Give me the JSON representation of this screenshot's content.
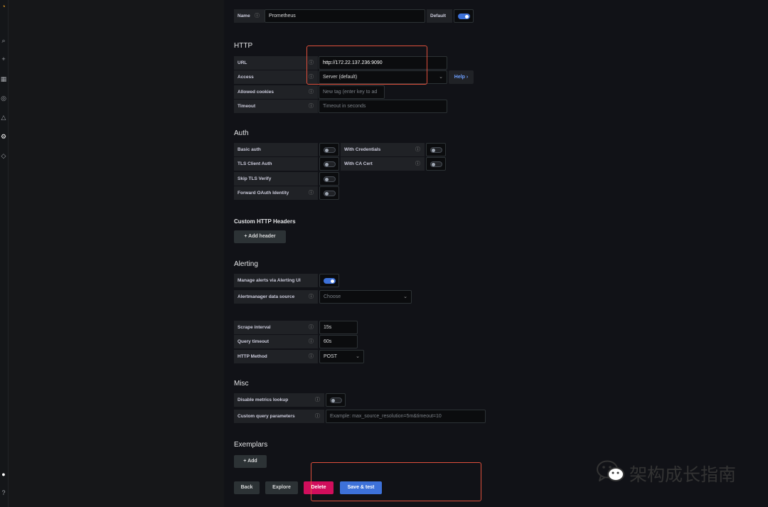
{
  "sidebar": {
    "icons": [
      "grafana-logo-icon",
      "search-icon",
      "plus-icon",
      "dashboards-icon",
      "explore-icon",
      "alerting-icon",
      "configuration-icon",
      "shield-icon",
      "user-avatar-icon",
      "help-icon"
    ]
  },
  "name_row": {
    "label": "Name",
    "value": "Prometheus",
    "default_label": "Default",
    "default_on": true
  },
  "http": {
    "title": "HTTP",
    "url_label": "URL",
    "url_value": "http://172.22.137.236:9090",
    "access_label": "Access",
    "access_value": "Server (default)",
    "help_label": "Help",
    "cookies_label": "Allowed cookies",
    "cookies_placeholder": "New tag (enter key to ad",
    "timeout_label": "Timeout",
    "timeout_placeholder": "Timeout in seconds"
  },
  "auth": {
    "title": "Auth",
    "basic_auth": "Basic auth",
    "with_credentials": "With Credentials",
    "tls_client_auth": "TLS Client Auth",
    "with_ca_cert": "With CA Cert",
    "skip_tls": "Skip TLS Verify",
    "forward_oauth": "Forward OAuth Identity"
  },
  "headers": {
    "title": "Custom HTTP Headers",
    "add_label": "+ Add header"
  },
  "alerting": {
    "title": "Alerting",
    "manage_label": "Manage alerts via Alerting UI",
    "manage_on": true,
    "am_label": "Alertmanager data source",
    "am_value": "Choose"
  },
  "prom": {
    "scrape_label": "Scrape interval",
    "scrape_value": "15s",
    "query_timeout_label": "Query timeout",
    "query_timeout_value": "60s",
    "method_label": "HTTP Method",
    "method_value": "POST"
  },
  "misc": {
    "title": "Misc",
    "disable_metrics_label": "Disable metrics lookup",
    "custom_params_label": "Custom query parameters",
    "custom_params_placeholder": "Example: max_source_resolution=5m&timeout=10"
  },
  "exemplars": {
    "title": "Exemplars",
    "add_label": "+ Add"
  },
  "footer": {
    "back": "Back",
    "explore": "Explore",
    "delete": "Delete",
    "save": "Save & test"
  },
  "watermark": {
    "text": "架构成长指南"
  },
  "colors": {
    "accent": "#3d71d9",
    "danger": "#d10e5c",
    "highlight": "#e0503c",
    "background": "#111217"
  }
}
